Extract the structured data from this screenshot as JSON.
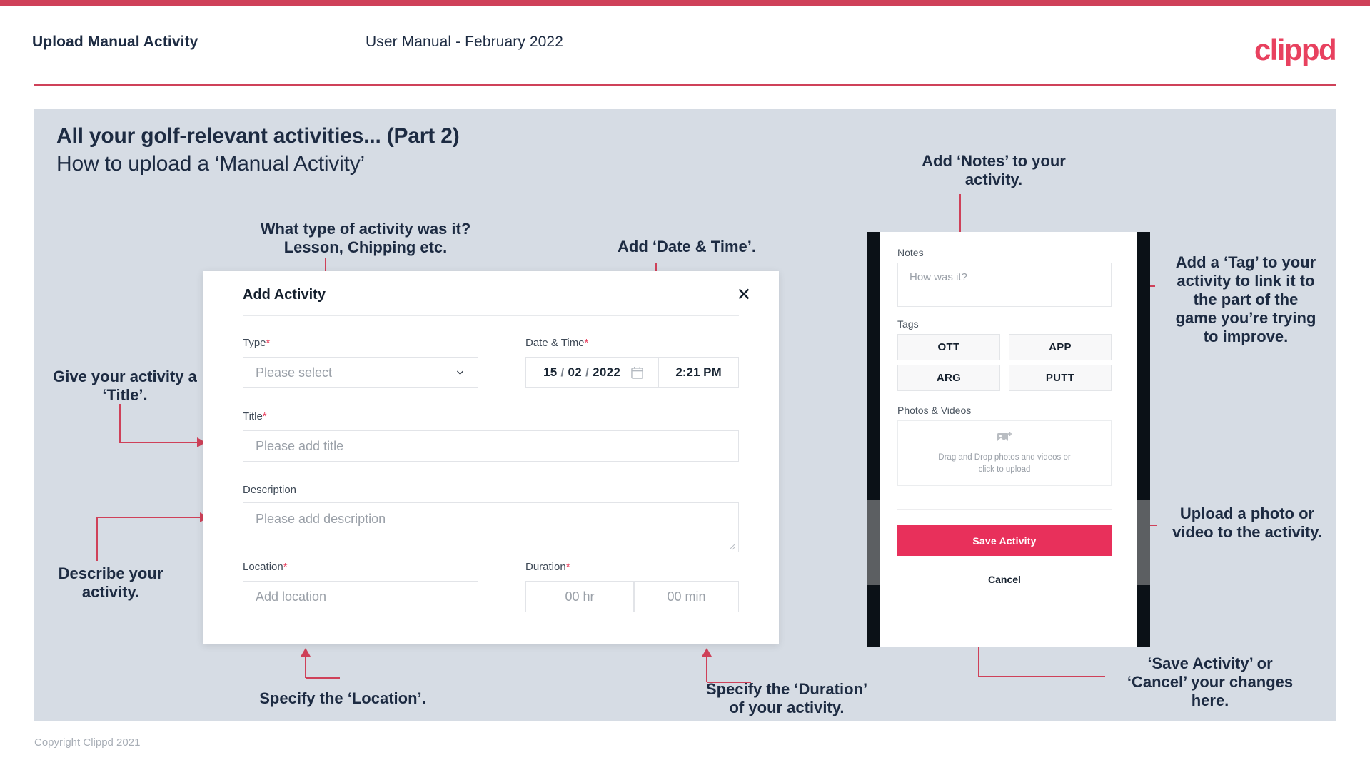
{
  "brand": {
    "logo_text": "clippd",
    "accent_red": "#cf4159",
    "accent_pink": "#e8305b",
    "panel_gray": "#d6dce4",
    "text_navy": "#1d2b42"
  },
  "header": {
    "title": "Upload Manual Activity",
    "subtitle": "User Manual - February 2022"
  },
  "slide": {
    "title": "All your golf-relevant activities... (Part 2)",
    "subtitle": "How to upload a ‘Manual Activity’"
  },
  "annotations": {
    "type": "What type of activity was it?\nLesson, Chipping etc.",
    "date_time": "Add ‘Date & Time’.",
    "title": "Give your activity a\n‘Title’.",
    "description": "Describe your\nactivity.",
    "location": "Specify the ‘Location’.",
    "duration": "Specify the ‘Duration’\nof your activity.",
    "notes": "Add ‘Notes’ to your\nactivity.",
    "tags": "Add a ‘Tag’ to your\nactivity to link it to\nthe part of the\ngame you’re trying\nto improve.",
    "photos": "Upload a photo or\nvideo to the activity.",
    "save_cancel": "‘Save Activity’ or\n‘Cancel’ your changes\nhere."
  },
  "dialog": {
    "title": "Add Activity",
    "close_icon": "close-icon",
    "fields": {
      "type": {
        "label": "Type",
        "required": "*",
        "placeholder": "Please select",
        "icon": "chevron-down-icon"
      },
      "date_time": {
        "label": "Date & Time",
        "required": "*",
        "day": "15",
        "sep1": "/",
        "month": "02",
        "sep2": "/",
        "year": "2022",
        "calendar_icon": "calendar-icon",
        "time": "2:21 PM"
      },
      "title": {
        "label": "Title",
        "required": "*",
        "placeholder": "Please add title"
      },
      "description": {
        "label": "Description",
        "required": "",
        "placeholder": "Please add description"
      },
      "location": {
        "label": "Location",
        "required": "*",
        "placeholder": "Add location"
      },
      "duration": {
        "label": "Duration",
        "required": "*",
        "hours_placeholder": "00 hr",
        "minutes_placeholder": "00 min"
      }
    }
  },
  "phone": {
    "notes": {
      "label": "Notes",
      "placeholder": "How was it?"
    },
    "tags": {
      "label": "Tags",
      "options": [
        "OTT",
        "APP",
        "ARG",
        "PUTT"
      ]
    },
    "photos": {
      "label": "Photos & Videos",
      "icon": "add-image-icon",
      "drop_text": "Drag and Drop photos and videos or\nclick to upload"
    },
    "save_label": "Save Activity",
    "cancel_label": "Cancel"
  },
  "footer": {
    "copyright": "Copyright Clippd 2021"
  }
}
